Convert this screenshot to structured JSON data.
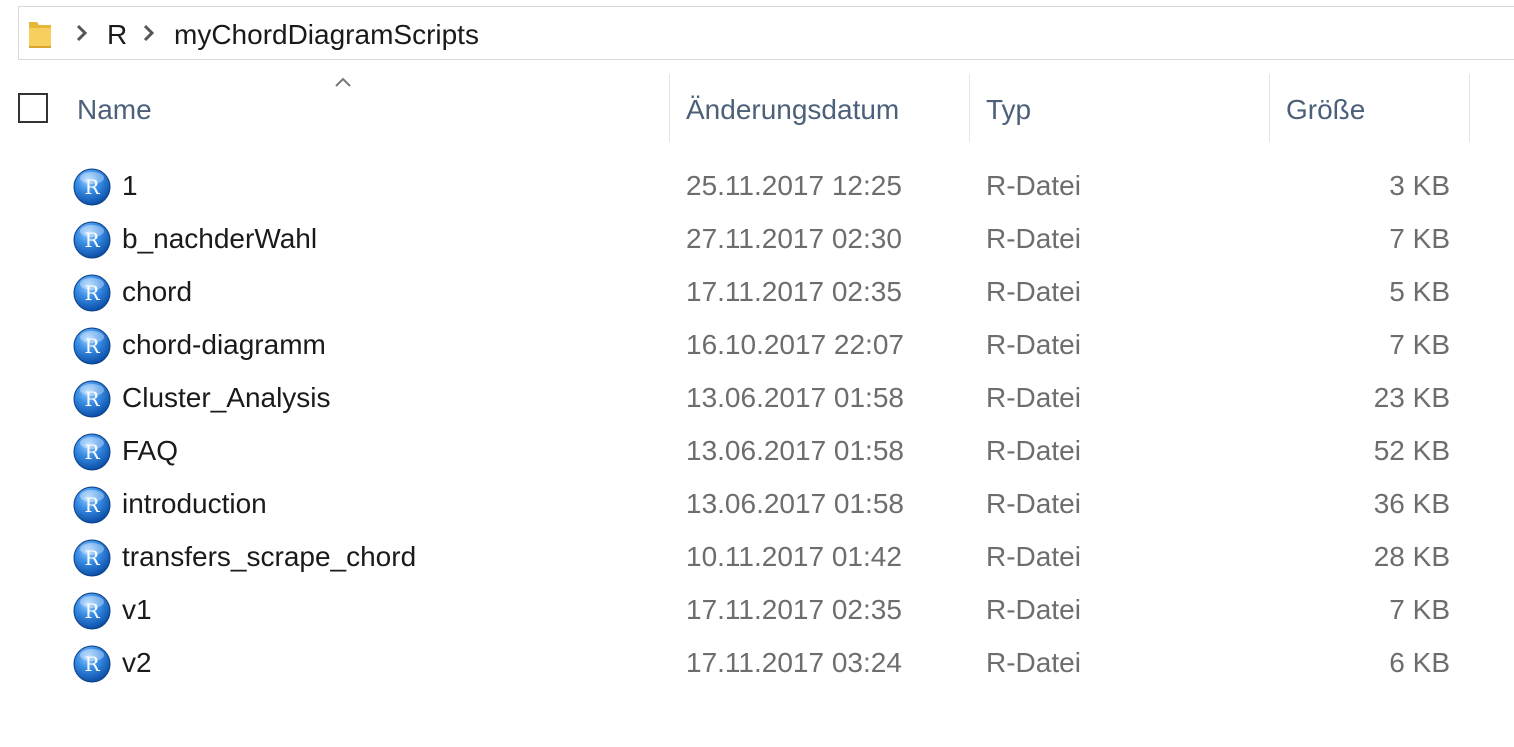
{
  "breadcrumb": {
    "items": [
      "R",
      "myChordDiagramScripts"
    ],
    "icon": "folder-icon",
    "separator_icon": "chevron-right-icon"
  },
  "columns": {
    "name": "Name",
    "date": "Änderungsdatum",
    "type": "Typ",
    "size": "Größe",
    "sorted_by": "Name",
    "sort_direction": "ascending"
  },
  "files": [
    {
      "name": "1",
      "date": "25.11.2017 12:25",
      "type": "R-Datei",
      "size": "3 KB"
    },
    {
      "name": "b_nachderWahl",
      "date": "27.11.2017 02:30",
      "type": "R-Datei",
      "size": "7 KB"
    },
    {
      "name": "chord",
      "date": "17.11.2017 02:35",
      "type": "R-Datei",
      "size": "5 KB"
    },
    {
      "name": "chord-diagramm",
      "date": "16.10.2017 22:07",
      "type": "R-Datei",
      "size": "7 KB"
    },
    {
      "name": "Cluster_Analysis",
      "date": "13.06.2017 01:58",
      "type": "R-Datei",
      "size": "23 KB"
    },
    {
      "name": "FAQ",
      "date": "13.06.2017 01:58",
      "type": "R-Datei",
      "size": "52 KB"
    },
    {
      "name": "introduction",
      "date": "13.06.2017 01:58",
      "type": "R-Datei",
      "size": "36 KB"
    },
    {
      "name": "transfers_scrape_chord",
      "date": "10.11.2017 01:42",
      "type": "R-Datei",
      "size": "28 KB"
    },
    {
      "name": "v1",
      "date": "17.11.2017 02:35",
      "type": "R-Datei",
      "size": "7 KB"
    },
    {
      "name": "v2",
      "date": "17.11.2017 03:24",
      "type": "R-Datei",
      "size": "6 KB"
    }
  ],
  "file_icon": "r-script-icon",
  "colors": {
    "header_text": "#4c607a",
    "primary_text": "#1a1a1a",
    "secondary_text": "#6d6d6d",
    "icon_blue": "#1f6fd0"
  }
}
